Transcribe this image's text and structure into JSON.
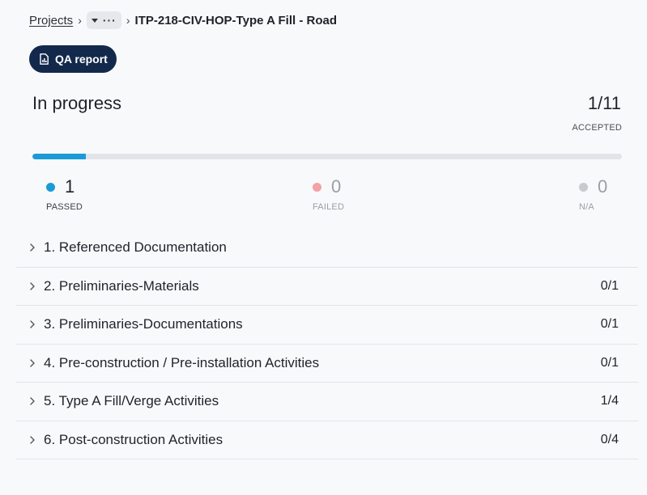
{
  "breadcrumb": {
    "root": "Projects",
    "current": "ITP-218-CIV-HOP-Type A Fill - Road"
  },
  "qa_button": {
    "label": "QA report"
  },
  "summary": {
    "status": "In progress",
    "accepted_count": "1/11",
    "accepted_label": "ACCEPTED",
    "progress_fraction": 0.091,
    "progress_color": "#1a9bd7",
    "passed": {
      "value": "1",
      "label": "PASSED",
      "color": "#1a9bd7"
    },
    "failed": {
      "value": "0",
      "label": "FAILED",
      "color": "#f4a1a6"
    },
    "na": {
      "value": "0",
      "label": "N/A",
      "color": "#c9cacd"
    }
  },
  "sections": [
    {
      "title": "1. Referenced Documentation",
      "count": ""
    },
    {
      "title": "2. Preliminaries-Materials",
      "count": "0/1"
    },
    {
      "title": "3. Preliminaries-Documentations",
      "count": "0/1"
    },
    {
      "title": "4. Pre-construction / Pre-installation Activities",
      "count": "0/1"
    },
    {
      "title": "5. Type A Fill/Verge Activities",
      "count": "1/4"
    },
    {
      "title": "6. Post-construction Activities",
      "count": "0/4"
    }
  ]
}
